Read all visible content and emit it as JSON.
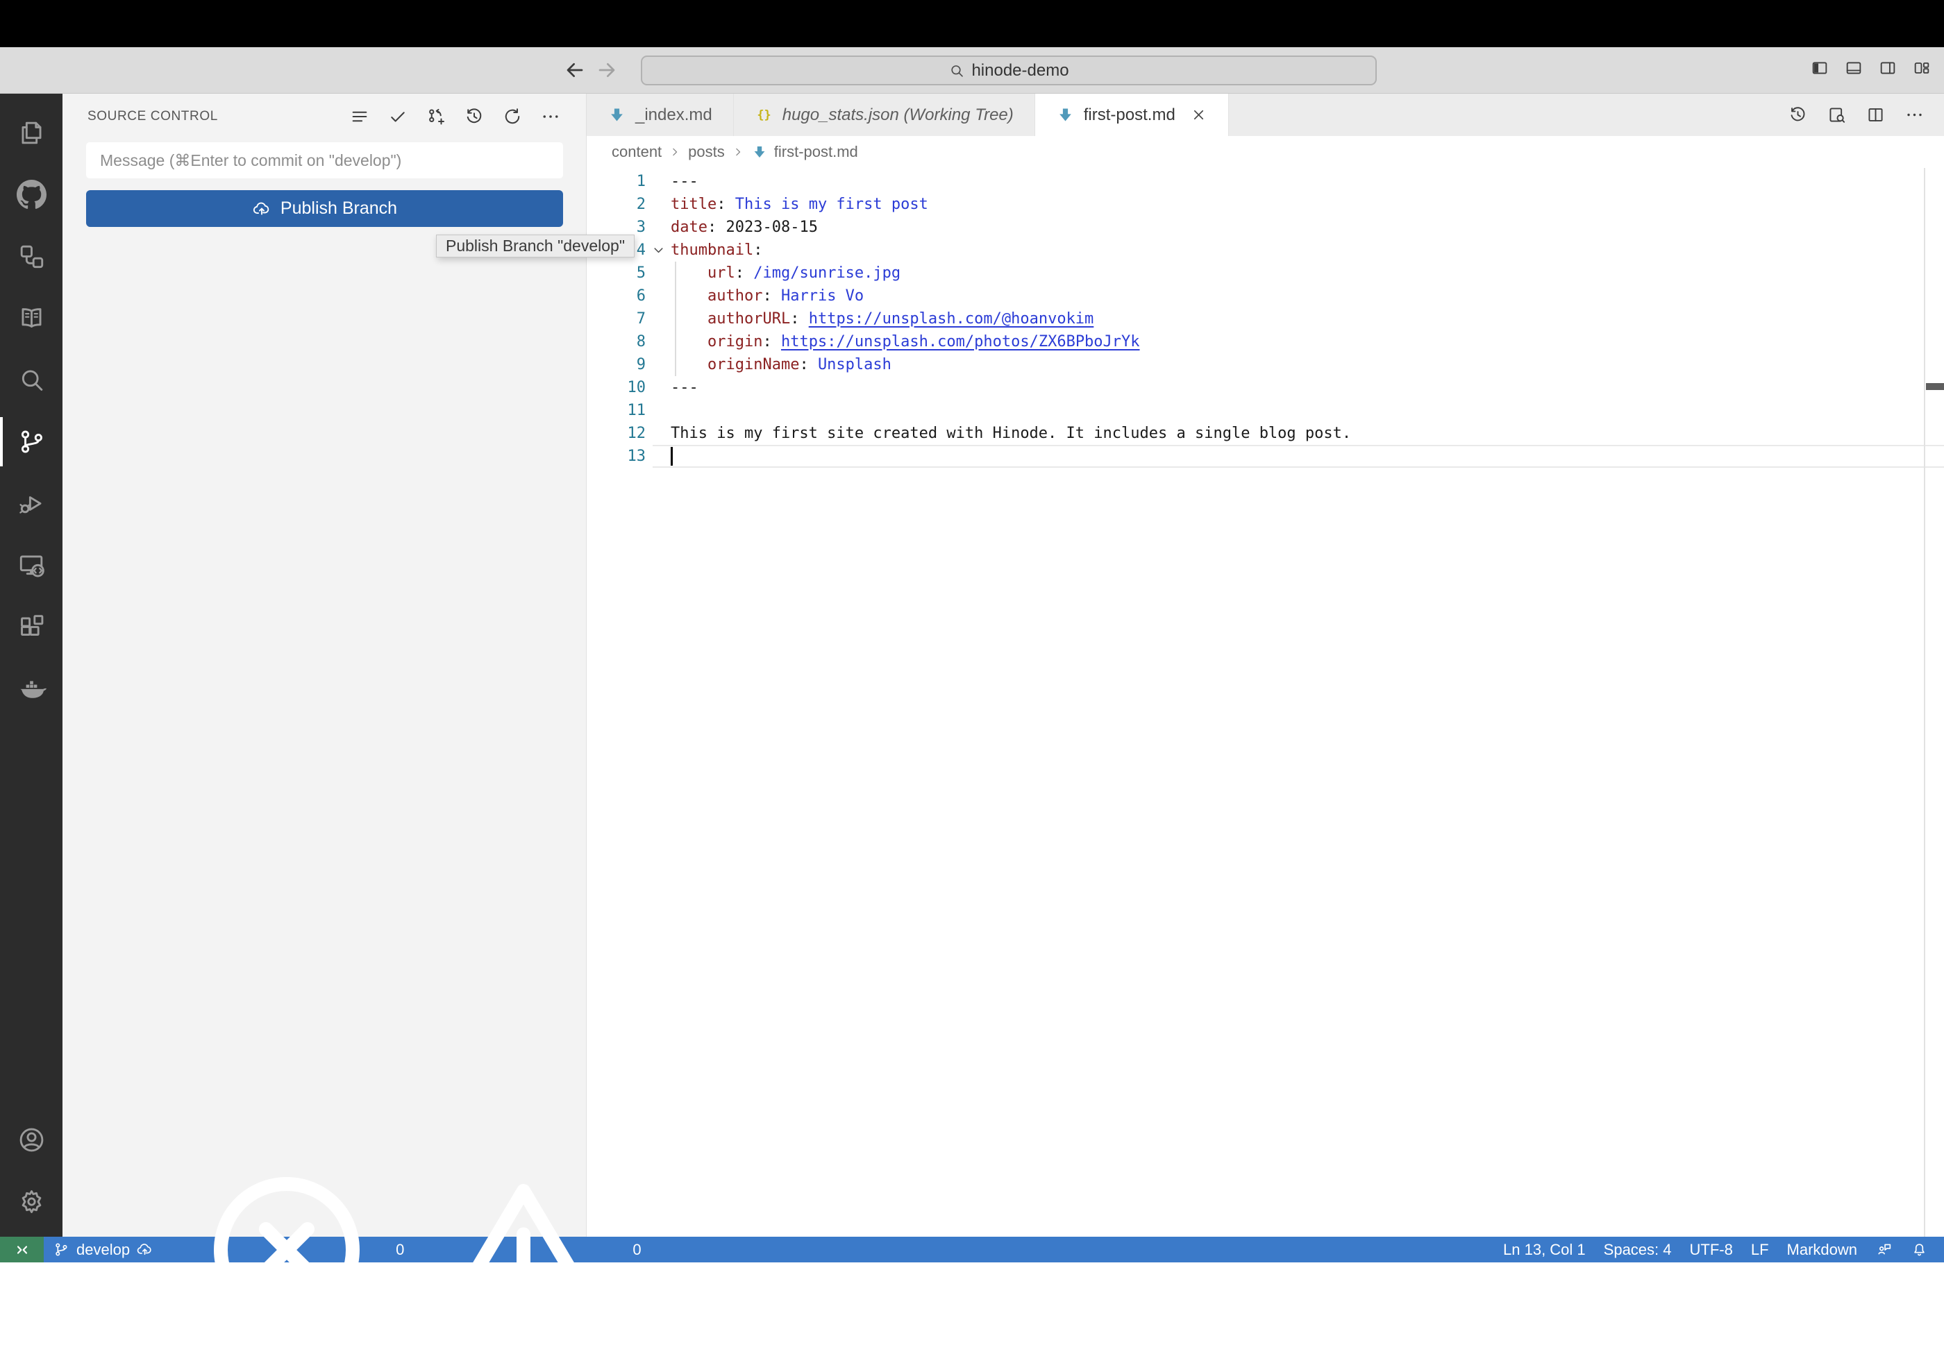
{
  "window": {
    "search_value": "hinode-demo"
  },
  "titlebar": {
    "back_icon": "arrow-left-icon",
    "forward_icon": "arrow-right-icon",
    "search_icon": "search-icon",
    "layout_buttons": [
      {
        "id": "toggle-primary-sidebar",
        "icon": "layout-sidebar-left-icon"
      },
      {
        "id": "toggle-panel",
        "icon": "layout-panel-icon"
      },
      {
        "id": "toggle-secondary-sidebar",
        "icon": "layout-sidebar-right-icon"
      },
      {
        "id": "customize-layout",
        "icon": "layout-customize-icon"
      }
    ]
  },
  "activity_bar": {
    "top": [
      {
        "id": "explorer",
        "icon": "files-icon",
        "active": false
      },
      {
        "id": "github",
        "icon": "github-icon",
        "active": false
      },
      {
        "id": "references",
        "icon": "references-icon",
        "active": false
      },
      {
        "id": "docs-book",
        "icon": "book-icon",
        "active": false
      },
      {
        "id": "search",
        "icon": "search-icon",
        "active": false
      },
      {
        "id": "source-control",
        "icon": "source-control-icon",
        "active": true
      },
      {
        "id": "run-debug",
        "icon": "run-debug-icon",
        "active": false
      },
      {
        "id": "remote-explorer",
        "icon": "remote-explorer-icon",
        "active": false
      },
      {
        "id": "extensions",
        "icon": "extensions-icon",
        "active": false
      },
      {
        "id": "docker",
        "icon": "docker-icon",
        "active": false
      }
    ],
    "bottom": [
      {
        "id": "account",
        "icon": "account-icon"
      },
      {
        "id": "settings",
        "icon": "settings-gear-icon"
      }
    ]
  },
  "sidebar": {
    "title": "SOURCE CONTROL",
    "toolbar": [
      {
        "id": "view-as-list",
        "icon": "view-list-icon"
      },
      {
        "id": "commit",
        "icon": "check-icon"
      },
      {
        "id": "create-branch",
        "icon": "create-branch-icon"
      },
      {
        "id": "history",
        "icon": "history-icon"
      },
      {
        "id": "refresh",
        "icon": "refresh-icon"
      },
      {
        "id": "more-actions",
        "icon": "ellipsis-icon"
      }
    ],
    "message_placeholder": "Message (⌘Enter to commit on \"develop\")",
    "publish_button": {
      "label": "Publish Branch",
      "icon": "cloud-upload-icon"
    }
  },
  "tooltip": {
    "text": "Publish Branch \"develop\""
  },
  "editor": {
    "tabs": [
      {
        "label": "_index.md",
        "icon": "markdown-file-icon",
        "active": false,
        "italic": false
      },
      {
        "label": "hugo_stats.json (Working Tree)",
        "icon": "json-file-icon",
        "active": false,
        "italic": true
      },
      {
        "label": "first-post.md",
        "icon": "markdown-file-icon",
        "active": true,
        "italic": false,
        "close_icon": "close-icon"
      }
    ],
    "actions": [
      {
        "id": "timeline",
        "icon": "history-icon"
      },
      {
        "id": "open-preview",
        "icon": "preview-icon"
      },
      {
        "id": "split-editor",
        "icon": "split-editor-icon"
      },
      {
        "id": "more-actions",
        "icon": "ellipsis-icon"
      }
    ],
    "breadcrumb": [
      {
        "label": "content"
      },
      {
        "label": "posts"
      },
      {
        "label": "first-post.md",
        "icon": "markdown-file-icon"
      }
    ],
    "lines": [
      {
        "num": "1",
        "segments": [
          {
            "text": "---",
            "style": "plain"
          }
        ]
      },
      {
        "num": "2",
        "segments": [
          {
            "text": "title",
            "style": "key"
          },
          {
            "text": ": ",
            "style": "plain"
          },
          {
            "text": "This is my first post",
            "style": "value"
          }
        ]
      },
      {
        "num": "3",
        "segments": [
          {
            "text": "date",
            "style": "key"
          },
          {
            "text": ": ",
            "style": "plain"
          },
          {
            "text": "2023-08-15",
            "style": "plain"
          }
        ]
      },
      {
        "num": "4",
        "fold": true,
        "segments": [
          {
            "text": "thumbnail",
            "style": "key"
          },
          {
            "text": ":",
            "style": "plain"
          }
        ]
      },
      {
        "num": "5",
        "guide": true,
        "segments": [
          {
            "text": "    ",
            "style": "plain"
          },
          {
            "text": "url",
            "style": "key"
          },
          {
            "text": ": ",
            "style": "plain"
          },
          {
            "text": "/img/sunrise.jpg",
            "style": "value"
          }
        ]
      },
      {
        "num": "6",
        "guide": true,
        "segments": [
          {
            "text": "    ",
            "style": "plain"
          },
          {
            "text": "author",
            "style": "key"
          },
          {
            "text": ": ",
            "style": "plain"
          },
          {
            "text": "Harris Vo",
            "style": "value"
          }
        ]
      },
      {
        "num": "7",
        "guide": true,
        "segments": [
          {
            "text": "    ",
            "style": "plain"
          },
          {
            "text": "authorURL",
            "style": "key"
          },
          {
            "text": ": ",
            "style": "plain"
          },
          {
            "text": "https://unsplash.com/@hoanvokim",
            "style": "link"
          }
        ]
      },
      {
        "num": "8",
        "guide": true,
        "segments": [
          {
            "text": "    ",
            "style": "plain"
          },
          {
            "text": "origin",
            "style": "key"
          },
          {
            "text": ": ",
            "style": "plain"
          },
          {
            "text": "https://unsplash.com/photos/ZX6BPboJrYk",
            "style": "link"
          }
        ]
      },
      {
        "num": "9",
        "guide": true,
        "segments": [
          {
            "text": "    ",
            "style": "plain"
          },
          {
            "text": "originName",
            "style": "key"
          },
          {
            "text": ": ",
            "style": "plain"
          },
          {
            "text": "Unsplash",
            "style": "value"
          }
        ]
      },
      {
        "num": "10",
        "segments": [
          {
            "text": "---",
            "style": "plain"
          }
        ]
      },
      {
        "num": "11",
        "segments": []
      },
      {
        "num": "12",
        "segments": [
          {
            "text": "This is my first site created with Hinode. It includes a single blog post.",
            "style": "plain"
          }
        ]
      },
      {
        "num": "13",
        "current": true,
        "cursor": true,
        "segments": []
      }
    ]
  },
  "status_bar": {
    "remote": {
      "icon": "remote-icon"
    },
    "branch": {
      "icon": "branch-icon",
      "label": "develop",
      "publish_icon": "cloud-upload-icon"
    },
    "problems": {
      "error_icon": "error-icon",
      "errors": "0",
      "warning_icon": "warning-icon",
      "warnings": "0"
    },
    "right": [
      {
        "id": "cursor-position",
        "label": "Ln 13, Col 1"
      },
      {
        "id": "indentation",
        "label": "Spaces: 4"
      },
      {
        "id": "encoding",
        "label": "UTF-8"
      },
      {
        "id": "eol",
        "label": "LF"
      },
      {
        "id": "language-mode",
        "label": "Markdown"
      },
      {
        "id": "feedback",
        "icon": "feedback-icon"
      },
      {
        "id": "notifications",
        "icon": "bell-icon"
      }
    ]
  },
  "colors": {
    "accent": "#2c63a9",
    "statusbar": "#3b7ac9",
    "remote_green": "#3d855c",
    "key": "#8b2121",
    "value": "#2b3cd6",
    "line_number": "#237893",
    "markdown_icon": "#519aba",
    "json_icon": "#c5b418"
  }
}
